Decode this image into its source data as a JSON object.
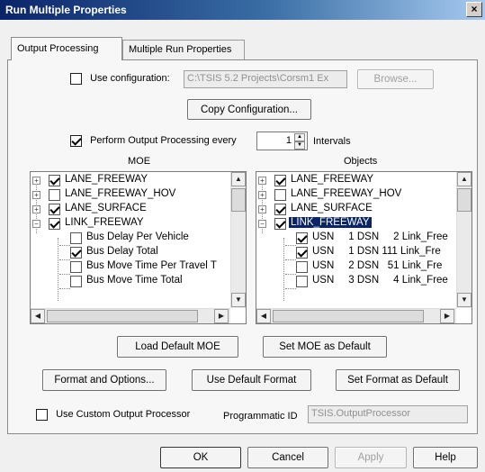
{
  "window": {
    "title": "Run Multiple Properties",
    "close": "×"
  },
  "tabs": [
    {
      "label": "Output Processing"
    },
    {
      "label": "Multiple Run Properties"
    }
  ],
  "config": {
    "use_configuration_label": "Use configuration:",
    "path_value": "C:\\TSIS 5.2 Projects\\Corsm1 Ex",
    "browse_label": "Browse...",
    "copy_label": "Copy Configuration..."
  },
  "perform": {
    "label": "Perform Output Processing every",
    "value": "1",
    "intervals_label": "Intervals"
  },
  "moe": {
    "header": "MOE",
    "items": [
      {
        "label": "LANE_FREEWAY"
      },
      {
        "label": "LANE_FREEWAY_HOV"
      },
      {
        "label": "LANE_SURFACE"
      },
      {
        "label": "LINK_FREEWAY"
      },
      {
        "label": "Bus Delay Per Vehicle"
      },
      {
        "label": "Bus Delay Total"
      },
      {
        "label": "Bus Move Time Per Travel T"
      },
      {
        "label": "Bus Move Time Total"
      }
    ]
  },
  "objects": {
    "header": "Objects",
    "items": [
      {
        "label": "LANE_FREEWAY"
      },
      {
        "label": "LANE_FREEWAY_HOV"
      },
      {
        "label": "LANE_SURFACE"
      },
      {
        "label": "LINK_FREEWAY"
      },
      {
        "label": "USN     1 DSN     2 Link_Free"
      },
      {
        "label": "USN     1 DSN 111 Link_Fre"
      },
      {
        "label": "USN     2 DSN   51 Link_Fre"
      },
      {
        "label": "USN     3 DSN     4 Link_Free"
      }
    ]
  },
  "buttons": {
    "load_default_moe": "Load Default MOE",
    "set_moe_default": "Set MOE as Default",
    "format_options": "Format and Options...",
    "use_default_format": "Use Default Format",
    "set_format_default": "Set Format as Default"
  },
  "custom": {
    "use_custom_label": "Use Custom Output Processor",
    "programmatic_id_label": "Programmatic ID",
    "programmatic_id_value": "TSIS.OutputProcessor"
  },
  "footer": {
    "ok": "OK",
    "cancel": "Cancel",
    "apply": "Apply",
    "help": "Help"
  }
}
